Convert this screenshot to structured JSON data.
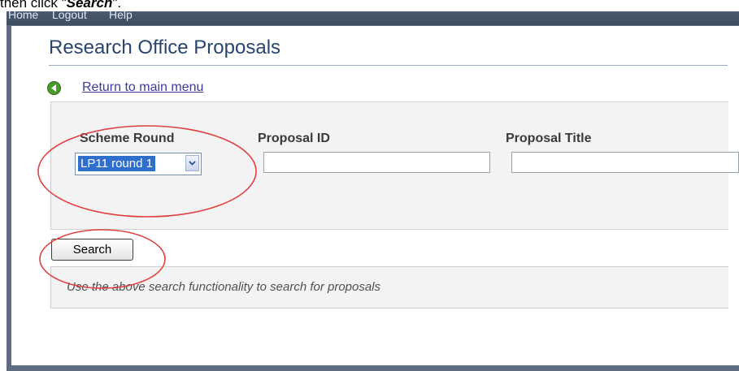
{
  "caption": {
    "prefix": "then click \"",
    "emphasis": "Search",
    "suffix": "\"."
  },
  "nav": {
    "items": [
      "Home",
      "Logout",
      "Help"
    ]
  },
  "page": {
    "title": "Research Office Proposals"
  },
  "back_link": {
    "label": "Return to main menu",
    "icon": "back-arrow-icon"
  },
  "search_form": {
    "fields": {
      "scheme_round": {
        "label": "Scheme Round",
        "value": "LP11 round 1"
      },
      "proposal_id": {
        "label": "Proposal ID",
        "value": ""
      },
      "proposal_title": {
        "label": "Proposal Title",
        "value": ""
      }
    },
    "search_label": "Search"
  },
  "hint": "Use the above search functionality to search for proposals",
  "colors": {
    "nav_bar": "#4a5a6f",
    "title": "#28456d",
    "link": "#3a3a9e",
    "back_icon": "#4a9a2a",
    "select_highlight": "#2f6ecb",
    "annotation": "#e0403f"
  }
}
